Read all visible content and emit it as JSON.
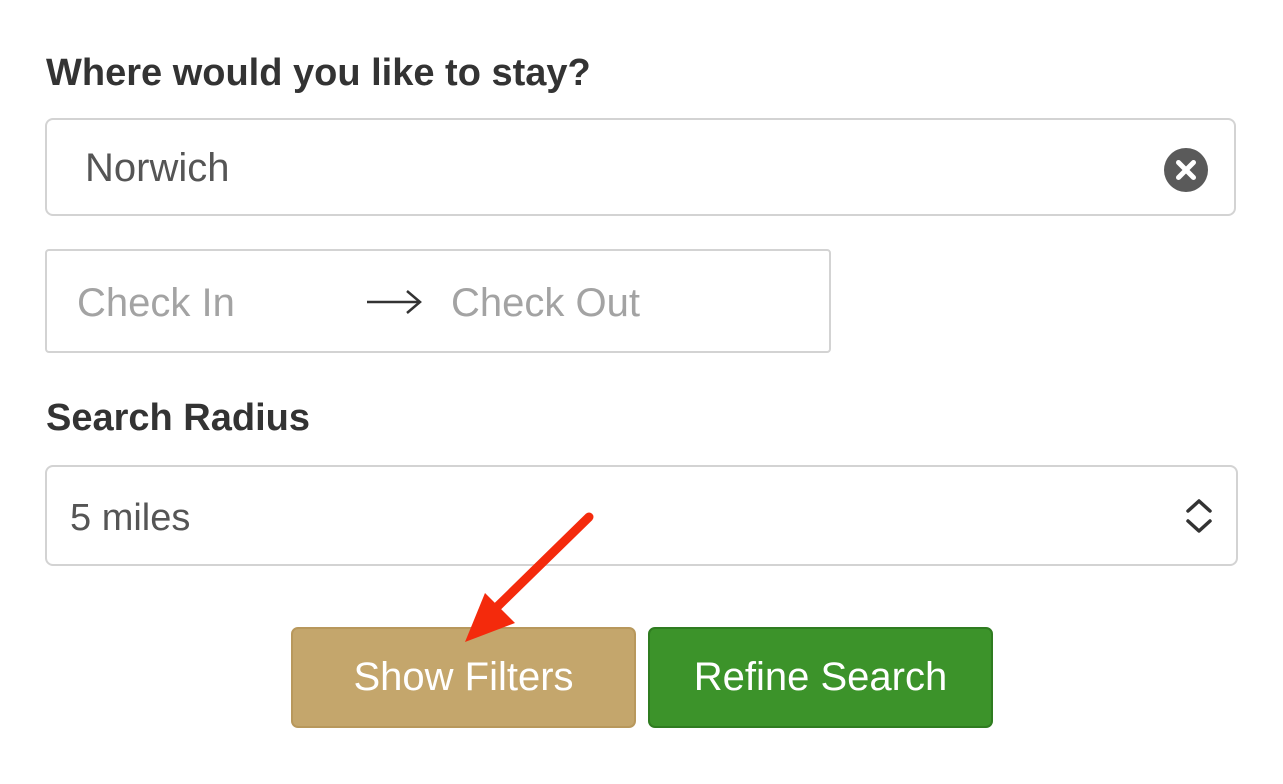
{
  "location": {
    "heading": "Where would you like to stay?",
    "value": "Norwich",
    "clear_icon": "close-circle-icon"
  },
  "dates": {
    "check_in_placeholder": "Check In",
    "check_out_placeholder": "Check Out",
    "arrow_icon": "arrow-right-icon"
  },
  "radius": {
    "heading": "Search Radius",
    "selected": "5 miles",
    "icon": "chevron-up-down-icon"
  },
  "buttons": {
    "show_filters": "Show Filters",
    "refine_search": "Refine Search"
  },
  "colors": {
    "show_filters_bg": "#c4a66c",
    "refine_search_bg": "#3c932a",
    "annotation_arrow": "#f42a0c"
  }
}
